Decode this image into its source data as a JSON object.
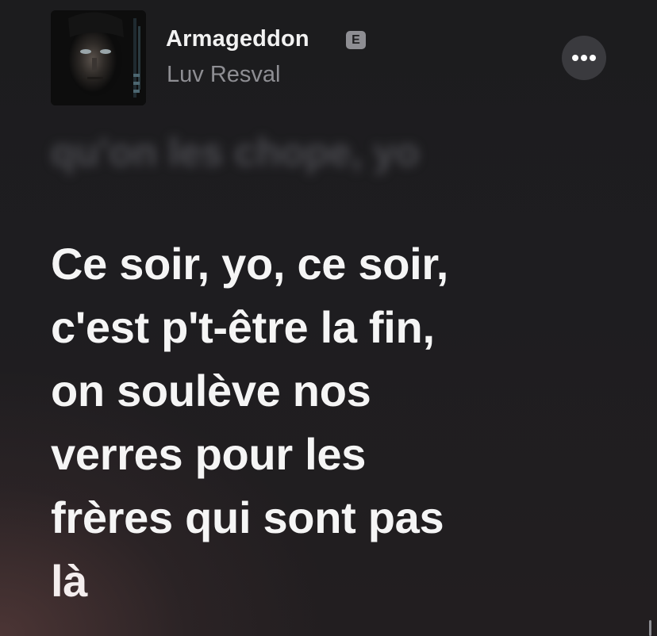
{
  "track": {
    "title": "Armageddon",
    "explicit_badge": "E",
    "artist": "Luv Resval",
    "artwork": "album-artwork-portrait"
  },
  "menu": {
    "icon": "ellipsis-icon"
  },
  "lyrics": {
    "previous_line": "qu'on les chope, yo",
    "current_line": [
      "Ce soir, yo, ce soir,",
      "c'est p't-être la fin,",
      "on soulève nos",
      "verres pour les",
      "frères qui sont pas",
      "là"
    ]
  },
  "colors": {
    "background": "#1c1c1e",
    "lyric_active": "#f5f5f5",
    "artist_text": "#8e8e93",
    "badge": "#8e8e93",
    "more_button_bg": "#3a3a3e"
  }
}
